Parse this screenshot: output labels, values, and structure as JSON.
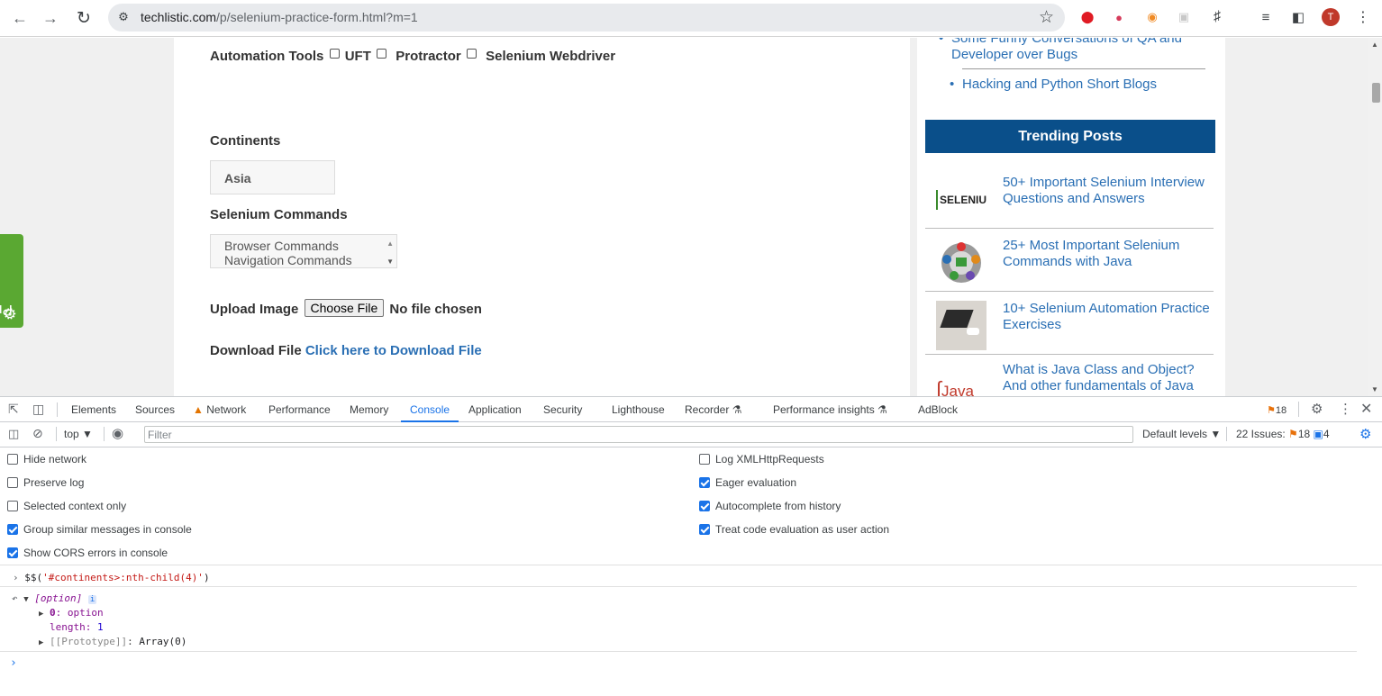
{
  "browser": {
    "url_host": "techlistic.com",
    "url_path": "/p/selenium-practice-form.html?m=1",
    "profile_initial": "T"
  },
  "form": {
    "automation_tools_label": "Automation Tools",
    "tool_uft": "UFT",
    "tool_protractor": "Protractor",
    "tool_selenium": "Selenium Webdriver",
    "continents_label": "Continents",
    "continents_selected": "Asia",
    "selenium_commands_label": "Selenium Commands",
    "commands_options": [
      "Browser Commands",
      "Navigation Commands"
    ],
    "upload_label": "Upload Image",
    "choose_file_label": "Choose File",
    "no_file_text": "No file chosen",
    "download_label": "Download File",
    "download_link": "Click here to Download File"
  },
  "privacy_tab": "Privacy",
  "sidebar": {
    "links": [
      "Some Funny Conversations of QA and Developer over Bugs",
      "Hacking and Python Short Blogs"
    ],
    "trending_title": "Trending Posts",
    "trending": [
      {
        "title": "50+ Important Selenium Interview Questions and Answers",
        "thumb": "SELENIU"
      },
      {
        "title": "25+ Most Important Selenium Commands with Java",
        "thumb": ""
      },
      {
        "title": "10+ Selenium Automation Practice Exercises",
        "thumb": ""
      },
      {
        "title": "What is Java Class and Object? And other fundamentals of Java",
        "thumb": "Java"
      }
    ]
  },
  "devtools": {
    "tabs": [
      "Elements",
      "Sources",
      "Network",
      "Performance",
      "Memory",
      "Console",
      "Application",
      "Security",
      "Lighthouse",
      "Recorder",
      "Performance insights",
      "AdBlock"
    ],
    "active_tab": "Console",
    "issues_badge": "18",
    "context": "top",
    "filter_placeholder": "Filter",
    "default_levels": "Default levels",
    "issues_summary": "22 Issues:",
    "issues_warn": "18",
    "issues_info": "4",
    "settings_left": [
      {
        "label": "Hide network",
        "checked": false
      },
      {
        "label": "Preserve log",
        "checked": false
      },
      {
        "label": "Selected context only",
        "checked": false
      },
      {
        "label": "Group similar messages in console",
        "checked": true
      },
      {
        "label": "Show CORS errors in console",
        "checked": true
      }
    ],
    "settings_right": [
      {
        "label": "Log XMLHttpRequests",
        "checked": false
      },
      {
        "label": "Eager evaluation",
        "checked": true
      },
      {
        "label": "Autocomplete from history",
        "checked": true
      },
      {
        "label": "Treat code evaluation as user action",
        "checked": true
      }
    ],
    "console": {
      "command_prefix": "$$(",
      "command_arg": "'#continents>:nth-child(4)'",
      "command_suffix": ")",
      "result_type": "[option]",
      "result_info": "i",
      "item0_key": "0",
      "item0_val": "option",
      "length_key": "length",
      "length_val": "1",
      "proto": "[[Prototype]]",
      "proto_val": "Array(0)"
    }
  }
}
